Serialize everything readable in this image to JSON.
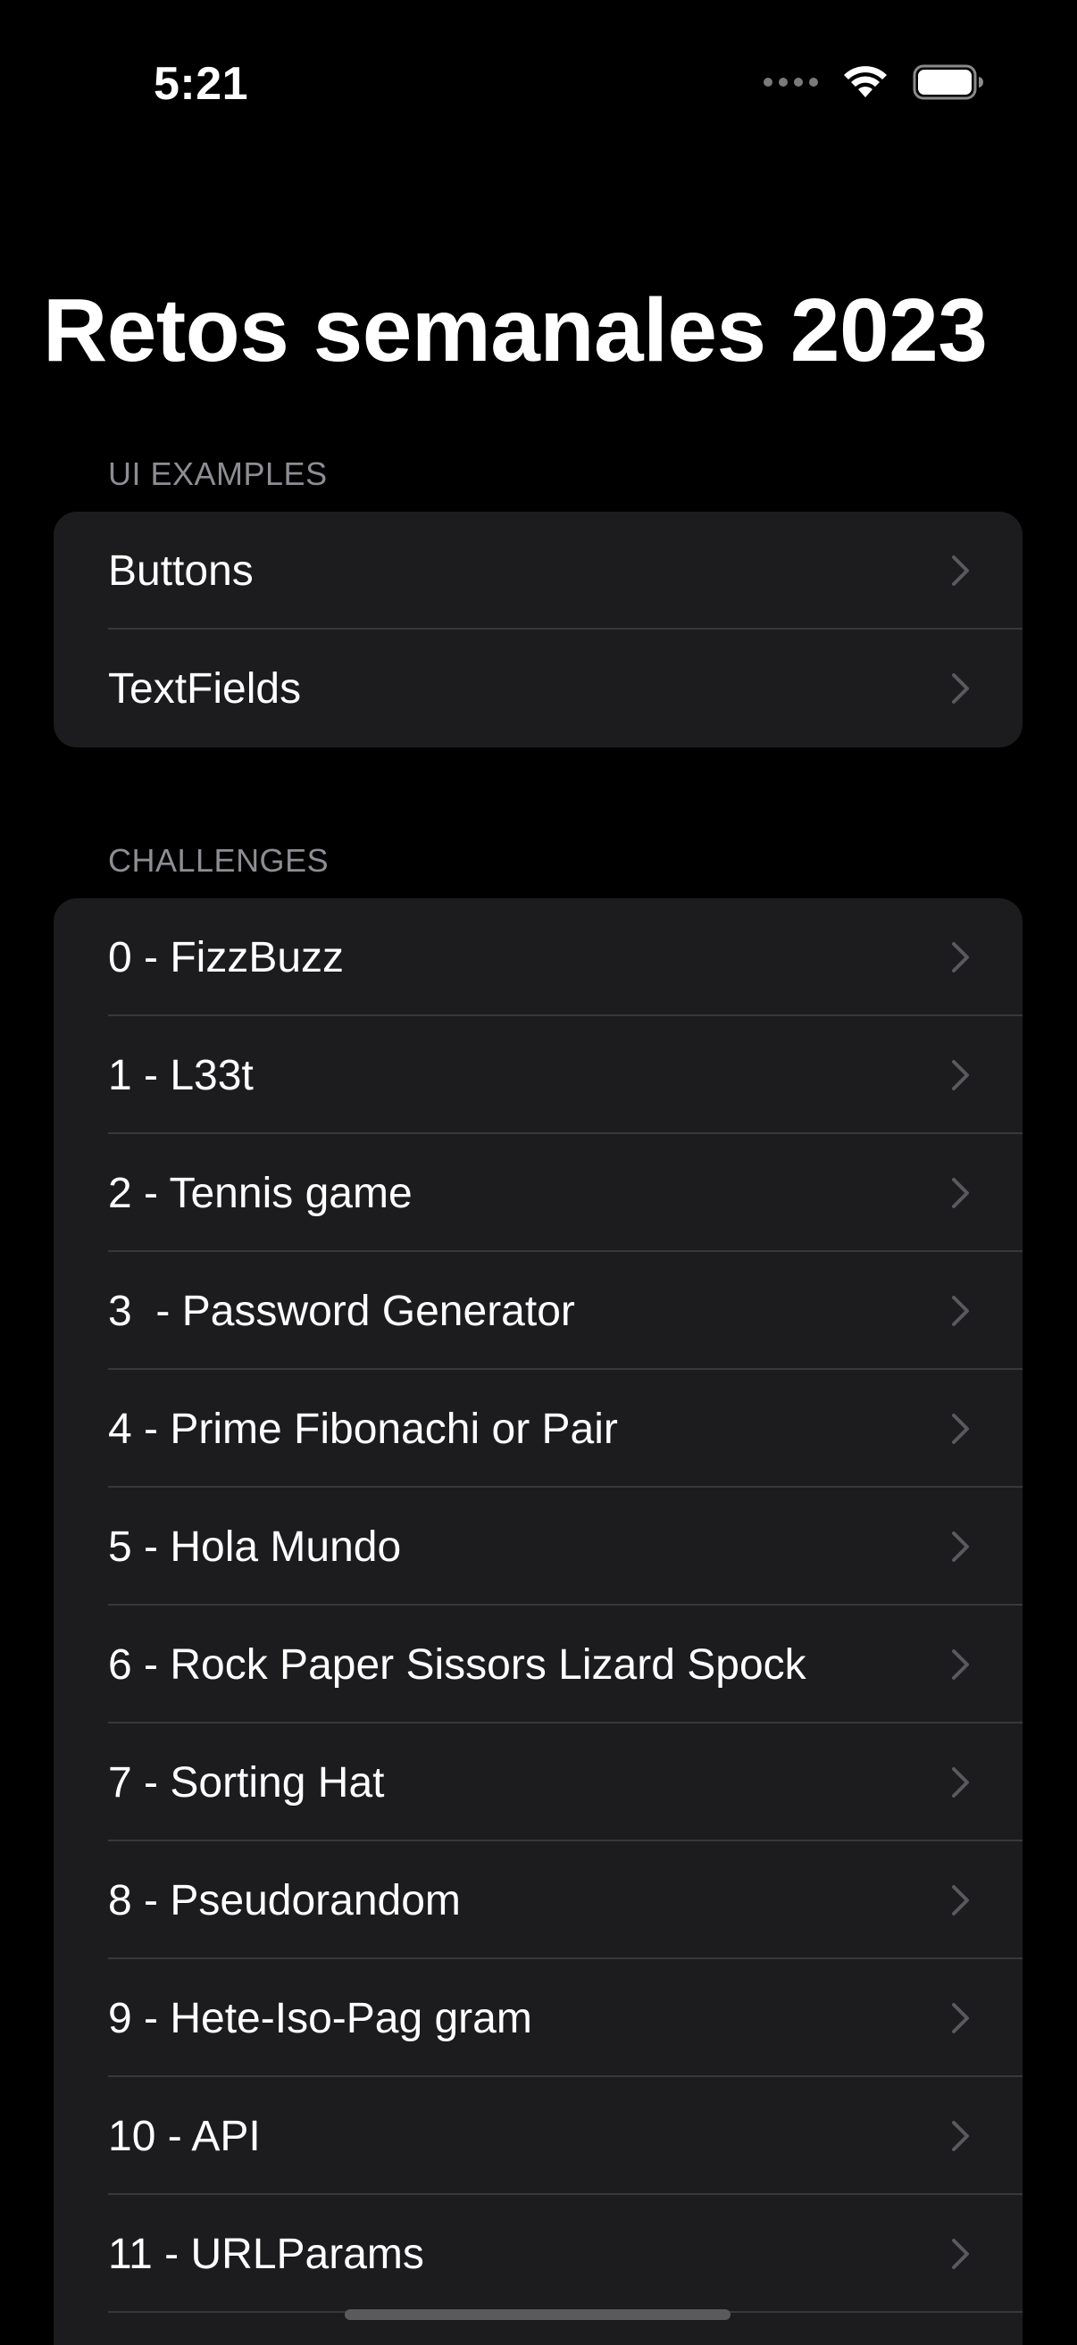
{
  "status_bar": {
    "time": "5:21",
    "icons": [
      "signal-dots-icon",
      "wifi-icon",
      "battery-icon"
    ]
  },
  "title": "Retos semanales 2023",
  "sections": [
    {
      "header": "UI EXAMPLES",
      "items": [
        {
          "label": "Buttons"
        },
        {
          "label": "TextFields"
        }
      ]
    },
    {
      "header": "CHALLENGES",
      "items": [
        {
          "label": "0 - FizzBuzz"
        },
        {
          "label": "1 - L33t"
        },
        {
          "label": "2 - Tennis game"
        },
        {
          "label": "3  - Password Generator"
        },
        {
          "label": "4 - Prime Fibonachi or Pair"
        },
        {
          "label": "5 - Hola Mundo"
        },
        {
          "label": "6 - Rock Paper Sissors Lizard Spock"
        },
        {
          "label": "7 - Sorting Hat"
        },
        {
          "label": "8 - Pseudorandom"
        },
        {
          "label": "9 - Hete-Iso-Pag gram"
        },
        {
          "label": "10 - API"
        },
        {
          "label": "11 - URLParams"
        }
      ]
    }
  ],
  "colors": {
    "background": "#000000",
    "cell_background": "#1c1c1e",
    "separator": "#38383a",
    "secondary_text": "#8d8d93",
    "chevron": "#5a5a5e"
  }
}
